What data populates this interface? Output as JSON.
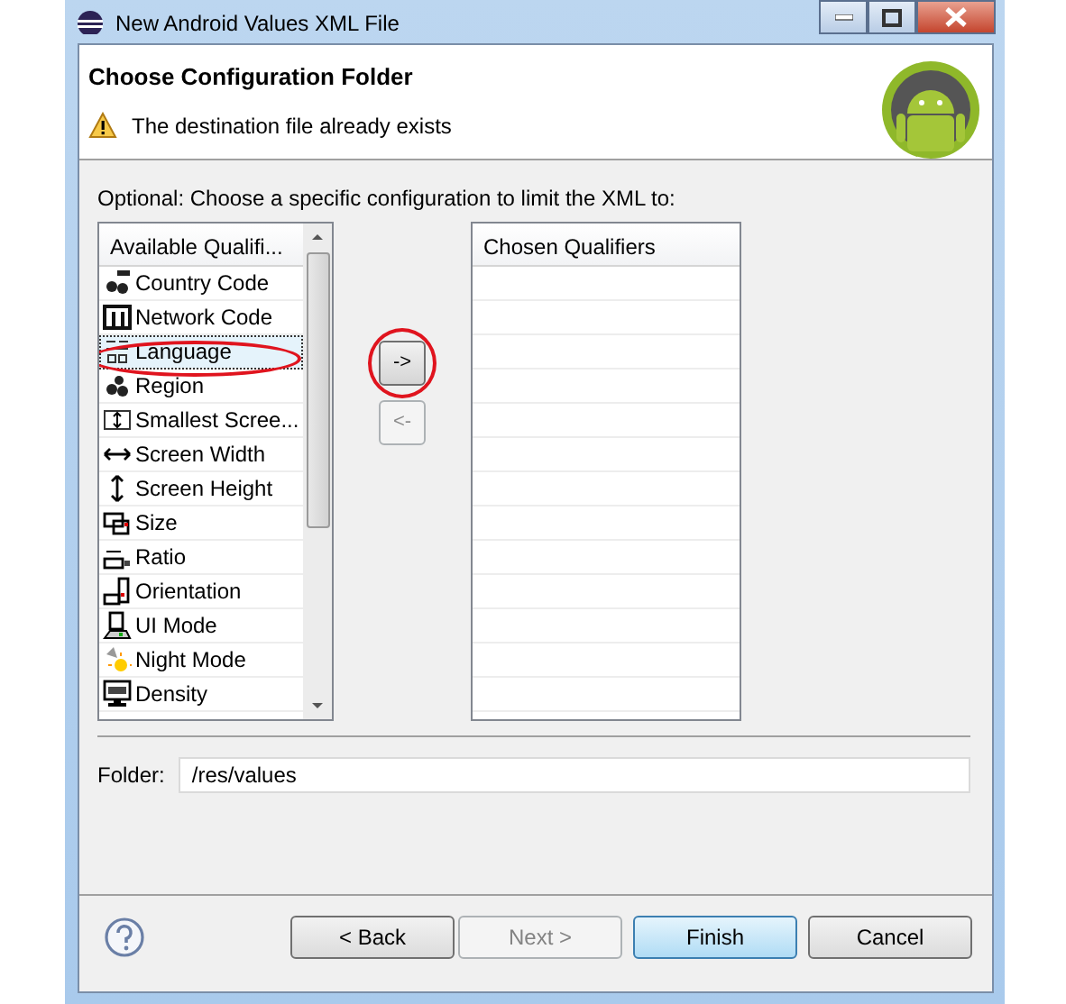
{
  "window": {
    "title": "New Android Values XML File"
  },
  "header": {
    "title": "Choose Configuration Folder",
    "message": "The destination file already exists"
  },
  "instructions": "Optional: Choose a specific configuration to limit the XML to:",
  "available": {
    "heading": "Available Qualifi...",
    "items": [
      {
        "label": "Country Code",
        "selected": false,
        "circled": false
      },
      {
        "label": "Network Code",
        "selected": false,
        "circled": false
      },
      {
        "label": "Language",
        "selected": true,
        "circled": true
      },
      {
        "label": "Region",
        "selected": false,
        "circled": false
      },
      {
        "label": "Smallest Scree...",
        "selected": false,
        "circled": false
      },
      {
        "label": "Screen Width",
        "selected": false,
        "circled": false
      },
      {
        "label": "Screen Height",
        "selected": false,
        "circled": false
      },
      {
        "label": "Size",
        "selected": false,
        "circled": false
      },
      {
        "label": "Ratio",
        "selected": false,
        "circled": false
      },
      {
        "label": "Orientation",
        "selected": false,
        "circled": false
      },
      {
        "label": "UI Mode",
        "selected": false,
        "circled": false
      },
      {
        "label": "Night Mode",
        "selected": false,
        "circled": false
      },
      {
        "label": "Density",
        "selected": false,
        "circled": false
      }
    ]
  },
  "move_buttons": [
    {
      "label": "->",
      "disabled": false,
      "circled": true
    },
    {
      "label": "<-",
      "disabled": true,
      "circled": false
    }
  ],
  "chosen": {
    "heading": "Chosen Qualifiers"
  },
  "folder": {
    "label": "Folder:",
    "value": "/res/values"
  },
  "buttons": [
    {
      "label": "< Back",
      "disabled": false,
      "default": false
    },
    {
      "label": "Next >",
      "disabled": true,
      "default": false
    },
    {
      "label": "Finish",
      "disabled": false,
      "default": true
    },
    {
      "label": "Cancel",
      "disabled": false,
      "default": false
    }
  ]
}
